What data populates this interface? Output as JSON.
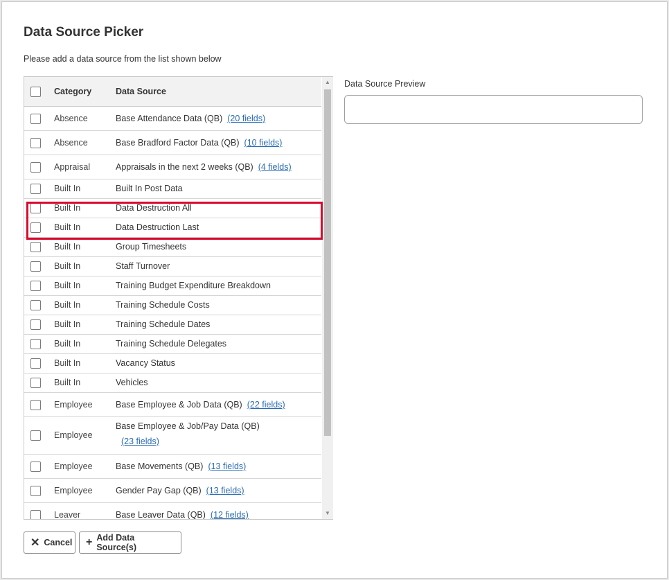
{
  "dialog": {
    "title": "Data Source Picker",
    "subtitle": "Please add a data source from the list shown below"
  },
  "grid": {
    "columns": {
      "category": "Category",
      "data_source": "Data Source"
    },
    "rows": [
      {
        "category": "Absence",
        "source": "Base Attendance Data (QB)",
        "fields": "(20 fields)"
      },
      {
        "category": "Absence",
        "source": "Base Bradford Factor Data (QB)",
        "fields": "(10 fields)"
      },
      {
        "category": "Appraisal",
        "source": "Appraisals in the next 2 weeks (QB)",
        "fields": "(4 fields)"
      },
      {
        "category": "Built In",
        "source": "Built In Post Data"
      },
      {
        "category": "Built In",
        "source": "Data Destruction All"
      },
      {
        "category": "Built In",
        "source": "Data Destruction Last"
      },
      {
        "category": "Built In",
        "source": "Group Timesheets"
      },
      {
        "category": "Built In",
        "source": "Staff Turnover"
      },
      {
        "category": "Built In",
        "source": "Training Budget Expenditure Breakdown"
      },
      {
        "category": "Built In",
        "source": "Training Schedule Costs"
      },
      {
        "category": "Built In",
        "source": "Training Schedule Dates"
      },
      {
        "category": "Built In",
        "source": "Training Schedule Delegates"
      },
      {
        "category": "Built In",
        "source": "Vacancy Status"
      },
      {
        "category": "Built In",
        "source": "Vehicles"
      },
      {
        "category": "Employee",
        "source": "Base Employee & Job Data (QB)",
        "fields": "(22 fields)"
      },
      {
        "category": "Employee",
        "source": "Base Employee & Job/Pay Data (QB)",
        "fields": "(23 fields)"
      },
      {
        "category": "Employee",
        "source": "Base Movements (QB)",
        "fields": "(13 fields)"
      },
      {
        "category": "Employee",
        "source": "Gender Pay Gap (QB)",
        "fields": "(13 fields)"
      },
      {
        "category": "Leaver",
        "source": "Base Leaver Data (QB)",
        "fields": "(12 fields)"
      }
    ]
  },
  "preview": {
    "label": "Data Source Preview",
    "value": ""
  },
  "buttons": {
    "cancel": "Cancel",
    "add": "Add Data Source(s)"
  },
  "colors": {
    "highlight": "#d80a2e",
    "link": "#2a6cb6"
  }
}
